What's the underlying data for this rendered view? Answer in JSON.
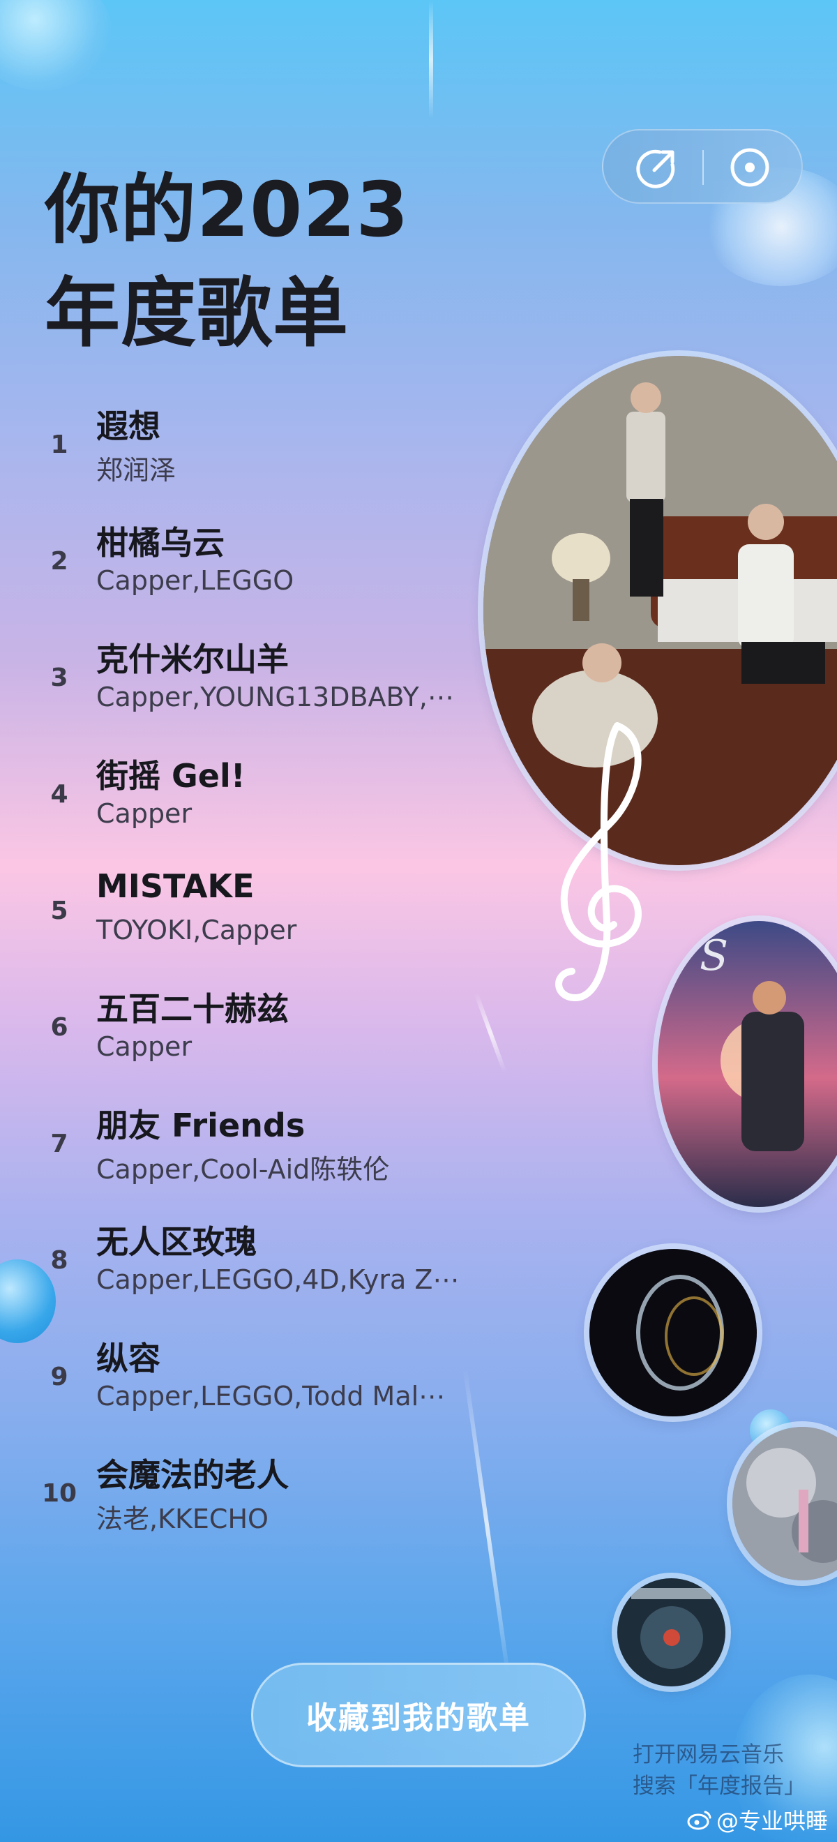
{
  "title_line1": "你的2023",
  "title_line2": "年度歌单",
  "toolbar": {
    "share_icon": "share-arrow-icon",
    "disc_icon": "disc-icon"
  },
  "tracks": [
    {
      "rank": "1",
      "title": "遐想",
      "artist": "郑润泽"
    },
    {
      "rank": "2",
      "title": "柑橘乌云",
      "artist": "Capper,LEGGO"
    },
    {
      "rank": "3",
      "title": "克什米尔山羊",
      "artist": "Capper,YOUNG13DBABY,⋯"
    },
    {
      "rank": "4",
      "title": "街摇 Gel!",
      "artist": "Capper"
    },
    {
      "rank": "5",
      "title": "MISTAKE",
      "artist": "TOYOKI,Capper"
    },
    {
      "rank": "6",
      "title": "五百二十赫兹",
      "artist": "Capper"
    },
    {
      "rank": "7",
      "title": "朋友 Friends",
      "artist": "Capper,Cool-Aid陈轶伦"
    },
    {
      "rank": "8",
      "title": "无人区玫瑰",
      "artist": "Capper,LEGGO,4D,Kyra Z⋯"
    },
    {
      "rank": "9",
      "title": "纵容",
      "artist": "Capper,LEGGO,Todd Mal⋯"
    },
    {
      "rank": "10",
      "title": "会魔法的老人",
      "artist": "法老,KKECHO"
    }
  ],
  "collect_button": "收藏到我的歌单",
  "hint_line1": "打开网易云音乐",
  "hint_line2": "搜索「年度报告」",
  "watermark": "@专业哄睡",
  "colors": {
    "accent": "#5cc6f6",
    "pink": "#fbc6e4",
    "title": "#1b1b22"
  }
}
